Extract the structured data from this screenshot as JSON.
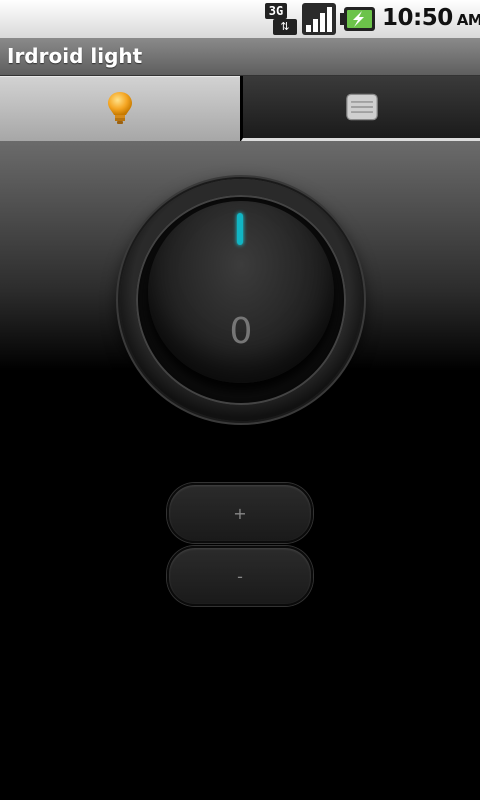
{
  "status_bar": {
    "network_label": "3G",
    "network_arrows": "⇅",
    "time": "10:50",
    "ampm": "AM",
    "icons": [
      "3g-data-icon",
      "signal-strength-icon",
      "battery-charging-icon"
    ]
  },
  "app": {
    "title": "Irdroid light"
  },
  "tabs": [
    {
      "name": "light",
      "icon": "light-bulb-icon",
      "selected": true
    },
    {
      "name": "remote",
      "icon": "remote-panel-icon",
      "selected": false
    }
  ],
  "knob": {
    "on_label": "I",
    "off_label": "0",
    "indicator_color": "#11b5c4"
  },
  "buttons": {
    "plus_label": "+",
    "minus_label": "-"
  },
  "colors": {
    "accent": "#11b5c4",
    "bulb": "#f5a623"
  }
}
